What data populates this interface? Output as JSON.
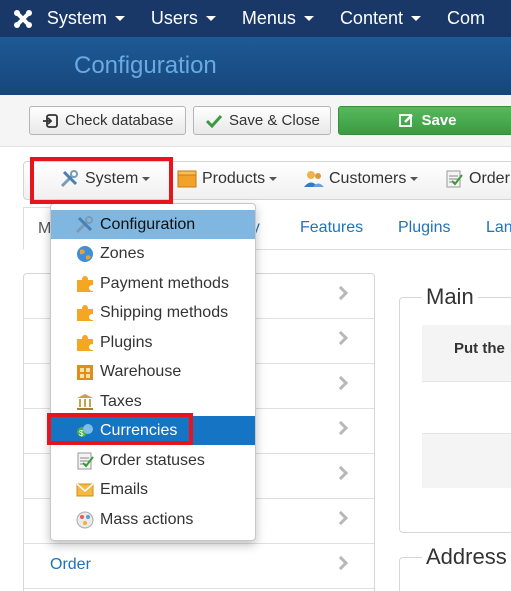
{
  "topnav": {
    "items": [
      {
        "label": "System"
      },
      {
        "label": "Users"
      },
      {
        "label": "Menus"
      },
      {
        "label": "Content"
      },
      {
        "label": "Com"
      }
    ]
  },
  "header": {
    "title": "Configuration"
  },
  "toolbar": {
    "check_database": "Check database",
    "save_close": "Save & Close",
    "save": "Save"
  },
  "menubar": {
    "items": [
      {
        "label": "System",
        "icon": "tools-icon"
      },
      {
        "label": "Products",
        "icon": "box-icon"
      },
      {
        "label": "Customers",
        "icon": "customers-icon"
      },
      {
        "label": "Order",
        "icon": "order-icon"
      }
    ]
  },
  "tabs": {
    "items": [
      {
        "label": "M"
      },
      {
        "label": "ay"
      },
      {
        "label": "Features"
      },
      {
        "label": "Plugins"
      },
      {
        "label": "Lan"
      }
    ]
  },
  "leftlist": {
    "rows": [
      {
        "label": ""
      },
      {
        "label": ""
      },
      {
        "label": ""
      },
      {
        "label": ""
      },
      {
        "label": ""
      },
      {
        "label": ""
      },
      {
        "label": "Order"
      }
    ]
  },
  "main": {
    "legend": "Main",
    "table_header": "Put the"
  },
  "address": {
    "legend": "Address"
  },
  "dropdown": {
    "items": [
      {
        "label": "Configuration",
        "icon": "tools-icon"
      },
      {
        "label": "Zones",
        "icon": "globe-icon"
      },
      {
        "label": "Payment methods",
        "icon": "puzzle-icon"
      },
      {
        "label": "Shipping methods",
        "icon": "puzzle-icon"
      },
      {
        "label": "Plugins",
        "icon": "puzzle-icon"
      },
      {
        "label": "Warehouse",
        "icon": "warehouse-icon"
      },
      {
        "label": "Taxes",
        "icon": "bank-icon"
      },
      {
        "label": "Currencies",
        "icon": "currency-icon"
      },
      {
        "label": "Order statuses",
        "icon": "checklist-icon"
      },
      {
        "label": "Emails",
        "icon": "email-icon"
      },
      {
        "label": "Mass actions",
        "icon": "mass-actions-icon"
      }
    ],
    "hover_item": "Configuration",
    "selected_item": "Currencies"
  },
  "colors": {
    "topnav_bg": "#1a3867",
    "header_bg": "#1a5289",
    "header_title": "#6aa9e4",
    "save_green": "#46a84b",
    "link_blue": "#1f72bd",
    "dropdown_selected": "#1574c4",
    "dropdown_hover": "#7fb7e0",
    "highlight_red": "#e8141c"
  }
}
